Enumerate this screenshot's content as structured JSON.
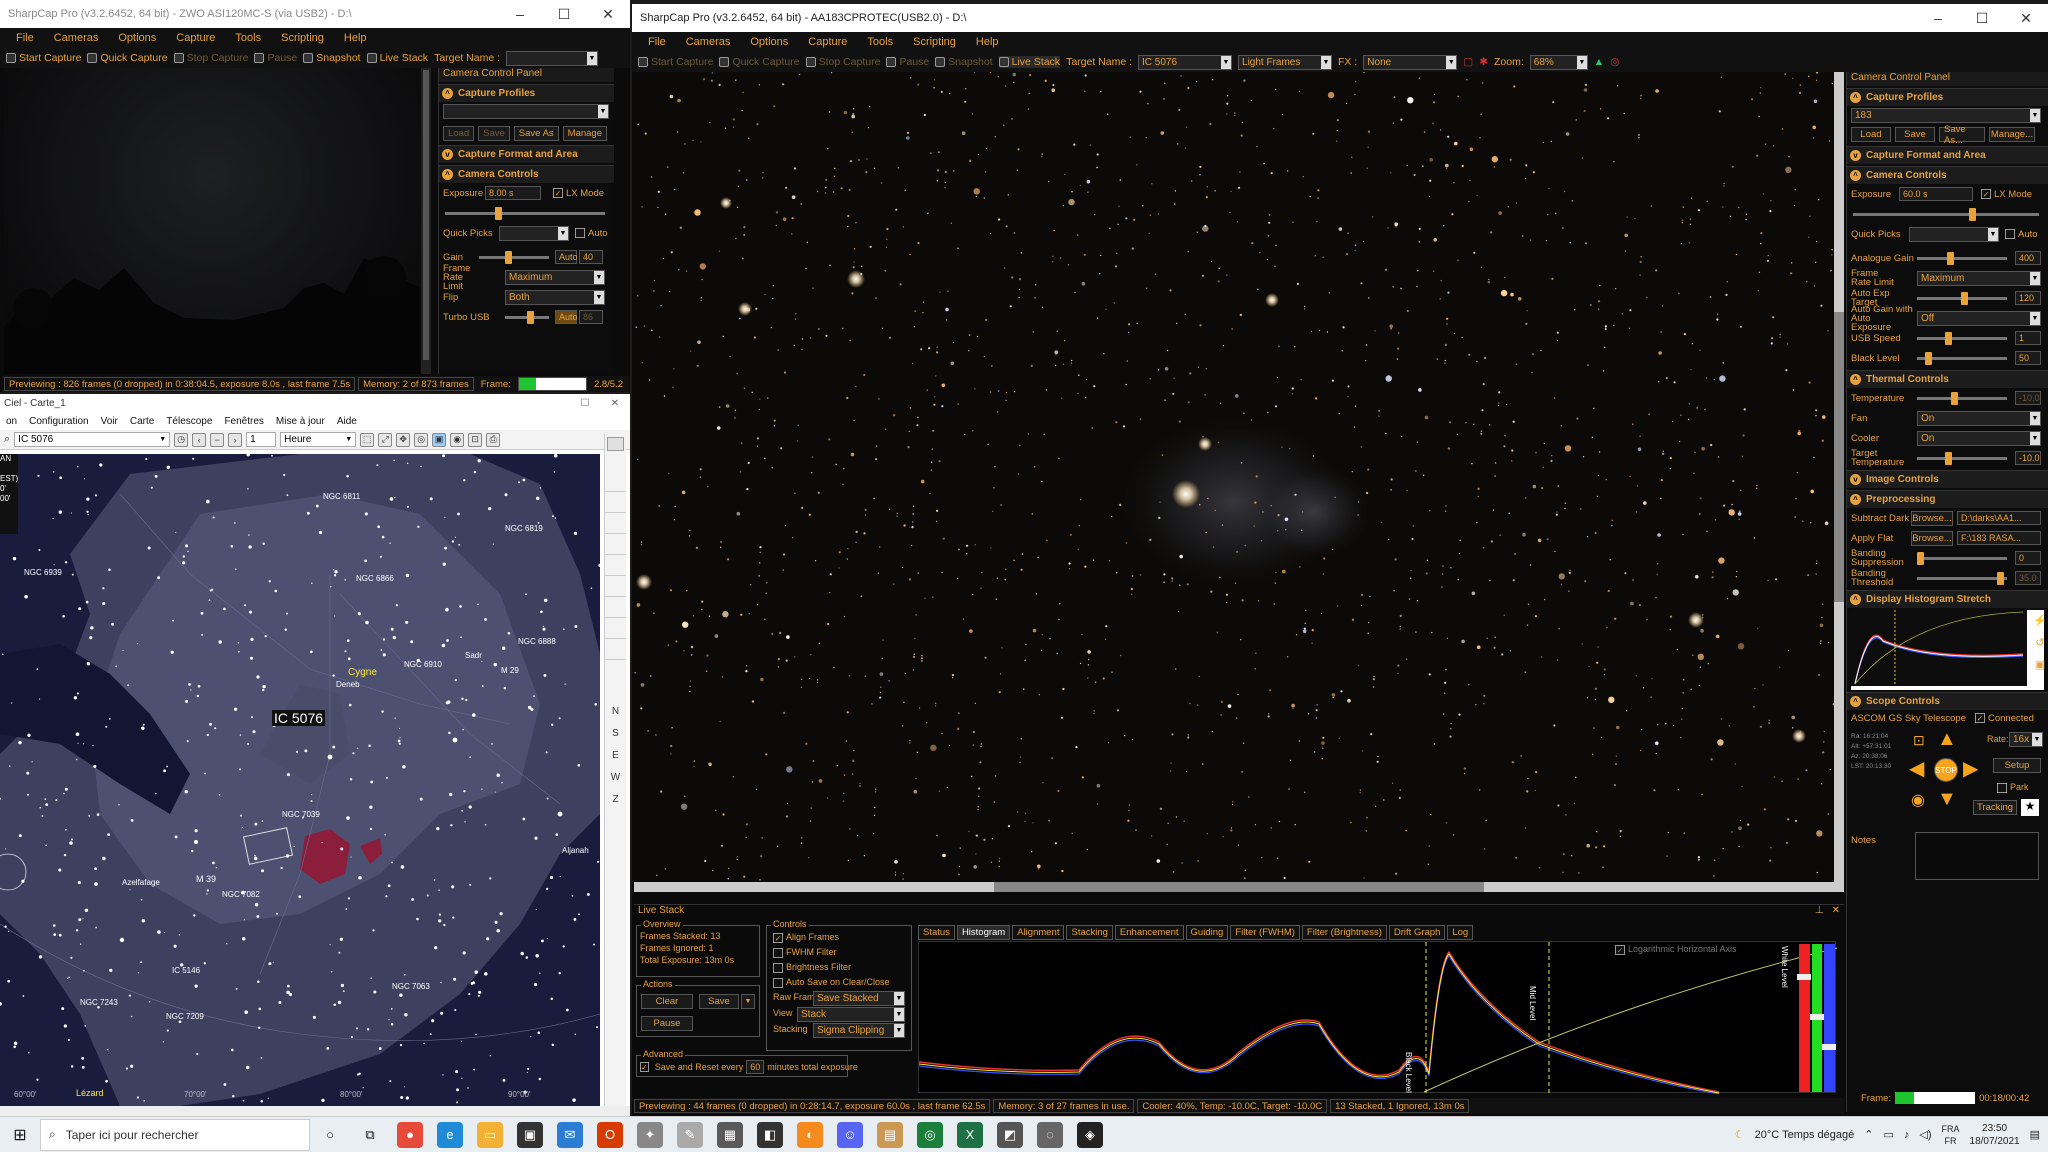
{
  "win1": {
    "title": "SharpCap Pro (v3.2.6452, 64 bit) - ZWO ASI120MC-S (via USB2) - D:\\",
    "menu": [
      "File",
      "Cameras",
      "Options",
      "Capture",
      "Tools",
      "Scripting",
      "Help"
    ],
    "toolbar": [
      "Start Capture",
      "Quick Capture",
      "Stop Capture",
      "Pause",
      "Snapshot",
      "Live Stack",
      "Target Name :"
    ],
    "panel_title": "Camera Control Panel",
    "sections": [
      "Capture Profiles",
      "Capture Format and Area",
      "Camera Controls"
    ],
    "profile_buttons": [
      "Load",
      "Save",
      "Save As",
      "Manage"
    ],
    "exposure_label": "Exposure",
    "exposure_value": "8.00 s",
    "lx_mode": "LX Mode",
    "quick_picks": "Quick Picks",
    "auto": "Auto",
    "gain_label": "Gain",
    "gain_auto": "Auto",
    "gain_value": "40",
    "frame_rate_label": "Frame Rate Limit",
    "frame_rate_value": "Maximum",
    "flip_label": "Flip",
    "flip_value": "Both",
    "turbo_label": "Turbo USB",
    "turbo_auto": "Auto",
    "turbo_value": "86",
    "status_preview": "Previewing : 826 frames (0 dropped) in 0:38:04.5, exposure 8.0s , last frame 7.5s",
    "status_memory": "Memory: 2 of 873 frames",
    "status_frame": "Frame:",
    "status_time": "2.8/5.2"
  },
  "ciel": {
    "title": "Ciel - Carte_1",
    "menu": [
      "on",
      "Configuration",
      "Voir",
      "Carte",
      "Télescope",
      "Fenêtres",
      "Mise à jour",
      "Aide"
    ],
    "search_value": "IC 5076",
    "step_value": "1",
    "unit_value": "Heure",
    "labels": {
      "ngc6811": "NGC 6811",
      "ngc6819": "NGC 6819",
      "ngc6866": "NGC 6866",
      "ngc6939": "NGC 6939",
      "ngc6888": "NGC 6888",
      "ngc6910": "NGC 6910",
      "m29": "M 29",
      "sadr": "Sadr",
      "deneb": "Deneb",
      "cygne": "Cygne",
      "ic5076": "IC 5076",
      "m39": "M 39",
      "ngc7082": "NGC 7082",
      "ngc7243": "NGC 7243",
      "ngc7209": "NGC 7209",
      "ngc7063": "NGC 7063",
      "ic5146": "IC 5146",
      "azelfafage": "Azelfafage",
      "aljanah": "Aljanah",
      "lezard": "Lézard",
      "ngc7039": "NGC 7039",
      "ra60": "60°00'",
      "ra70": "70°00'",
      "ra80": "80°00'",
      "ra90": "90°00'",
      "left1": "AN",
      "left2": "EST)",
      "left3": "0'",
      "left4": "00'"
    },
    "side_tools": [
      "N",
      "S",
      "E",
      "W",
      "Z"
    ]
  },
  "win2": {
    "title": "SharpCap Pro (v3.2.6452, 64 bit) - AA183CPROTEC(USB2.0) - D:\\",
    "menu": [
      "File",
      "Cameras",
      "Options",
      "Capture",
      "Tools",
      "Scripting",
      "Help"
    ],
    "toolbar": [
      "Start Capture",
      "Quick Capture",
      "Stop Capture",
      "Pause",
      "Snapshot",
      "Live Stack",
      "Target Name :"
    ],
    "target_name": "IC 5076",
    "frame_type": "Light Frames",
    "fx_label": "FX :",
    "fx_value": "None",
    "zoom_label": "Zoom:",
    "zoom_value": "68%",
    "panel_title": "Camera Control Panel",
    "profile_value": "183",
    "profile_buttons": [
      "Load",
      "Save",
      "Save As...",
      "Manage..."
    ],
    "sections": {
      "profiles": "Capture Profiles",
      "format": "Capture Format and Area",
      "camera": "Camera Controls",
      "thermal": "Thermal Controls",
      "image": "Image Controls",
      "preproc": "Preprocessing",
      "histogram": "Display Histogram Stretch",
      "scope": "Scope Controls"
    },
    "exposure_label": "Exposure",
    "exposure_value": "60.0 s",
    "lx_mode": "LX Mode",
    "quick_picks": "Quick Picks",
    "auto": "Auto",
    "analogue_gain_label": "Analogue Gain",
    "analogue_gain_value": "400",
    "frame_rate_label": "Frame Rate Limit",
    "frame_rate_value": "Maximum",
    "auto_exp_label": "Auto Exp Target",
    "auto_exp_value": "120",
    "auto_gain_label": "Auto Gain with Auto Exposure",
    "auto_gain_value": "Off",
    "usb_speed_label": "USB Speed",
    "usb_speed_value": "1",
    "black_level_label": "Black Level",
    "black_level_value": "50",
    "temperature_label": "Temperature",
    "temperature_value": "-10.0",
    "fan_label": "Fan",
    "fan_value": "On",
    "cooler_label": "Cooler",
    "cooler_value": "On",
    "target_temp_label": "Target Temperature",
    "target_temp_value": "-10.0",
    "subtract_dark_label": "Subtract Dark",
    "subtract_dark_value": "D:\\darks\\AA1...",
    "apply_flat_label": "Apply Flat",
    "apply_flat_value": "F:\\183 RASA...",
    "browse": "Browse...",
    "banding_supp_label": "Banding Suppression",
    "banding_supp_value": "0",
    "banding_thr_label": "Banding Threshold",
    "banding_thr_value": "35.0",
    "scope_name": "ASCOM GS Sky Telescope",
    "connected": "Connected",
    "rate_label": "Rate:",
    "rate_value": "16x",
    "setup": "Setup",
    "stop": "STOP",
    "park": "Park",
    "tracking": "Tracking",
    "notes": "Notes",
    "coords": [
      "Ra: 16:21:04",
      "Alt: +57:31:01",
      "Az: 20:38:06",
      "LST: 20:13:30"
    ],
    "frame_label": "Frame:",
    "frame_time": "00:18/00:42",
    "status": [
      "Previewing : 44 frames (0 dropped) in 0:28:14.7, exposure 60.0s , last frame 62.5s",
      "Memory: 3 of 27 frames in use.",
      "Cooler: 40%, Temp: -10.0C, Target: -10.0C",
      "13 Stacked, 1 Ignored, 13m 0s"
    ]
  },
  "livestack": {
    "title": "Live Stack",
    "overview": "Overview",
    "frames_stacked_label": "Frames Stacked:",
    "frames_stacked": "13",
    "frames_ignored_label": "Frames Ignored:",
    "frames_ignored": "1",
    "total_exposure_label": "Total Exposure:",
    "total_exposure": "13m 0s",
    "actions": "Actions",
    "clear": "Clear",
    "save": "Save",
    "pause": "Pause",
    "advanced": "Advanced",
    "save_reset": "Save and Reset every",
    "save_reset_value": "60",
    "save_reset_unit": "minutes total exposure",
    "controls": "Controls",
    "align": "Align Frames",
    "fwhm": "FWHM Filter",
    "brightness": "Brightness Filter",
    "autosave": "Auto Save on Clear/Close",
    "raw_frames_label": "Raw Frames",
    "raw_frames_value": "Save Stacked",
    "view_label": "View",
    "view_value": "Stack",
    "stacking_label": "Stacking",
    "stacking_value": "Sigma Clipping",
    "tabs": [
      "Status",
      "Histogram",
      "Alignment",
      "Stacking",
      "Enhancement",
      "Guiding",
      "Filter (FWHM)",
      "Filter (Brightness)",
      "Drift Graph",
      "Log"
    ],
    "log_axis": "Logarithmic Horizontal Axis",
    "black_level": "Black Level",
    "mid_level": "Mid Level",
    "white_level": "White Level"
  },
  "taskbar": {
    "search": "Taper ici pour rechercher",
    "weather": "20°C  Temps dégagé",
    "lang1": "FRA",
    "lang2": "FR",
    "time": "23:50",
    "date": "18/07/2021"
  }
}
